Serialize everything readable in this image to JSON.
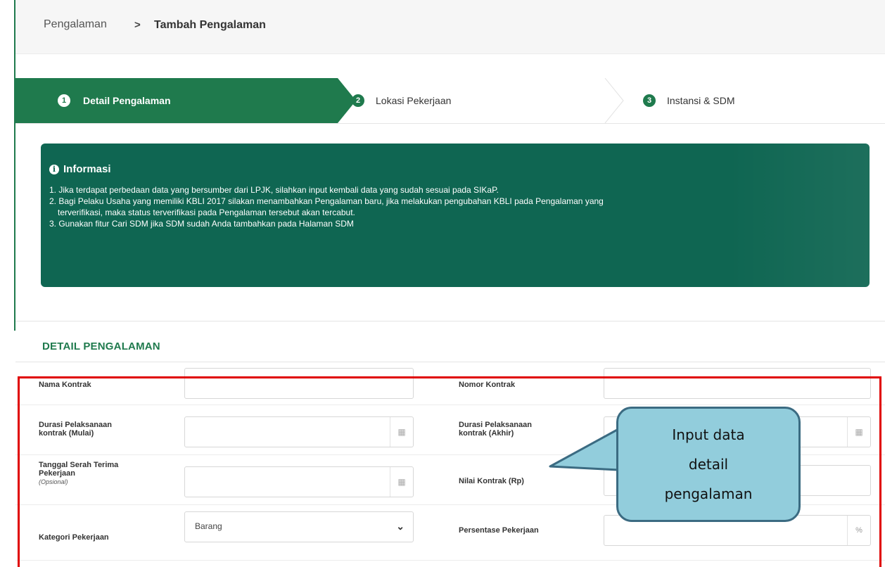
{
  "breadcrumb": {
    "root": "Pengalaman",
    "separator": ">",
    "current": "Tambah Pengalaman"
  },
  "steps": [
    {
      "num": "1",
      "label": "Detail Pengalaman",
      "active": true
    },
    {
      "num": "2",
      "label": "Lokasi Pekerjaan",
      "active": false
    },
    {
      "num": "3",
      "label": "Instansi & SDM",
      "active": false
    }
  ],
  "info": {
    "title": "Informasi",
    "items": [
      "1. Jika terdapat perbedaan data yang bersumber dari LPJK, silahkan input kembali data yang sudah sesuai pada SIKaP.",
      "2. Bagi Pelaku Usaha yang memiliki KBLI 2017 silakan menambahkan Pengalaman baru, jika melakukan pengubahan KBLI pada Pengalaman yang",
      "terverifikasi, maka status terverifikasi pada Pengalaman tersebut akan tercabut.",
      "3. Gunakan fitur Cari SDM jika SDM sudah Anda tambahkan pada Halaman SDM"
    ]
  },
  "section_title": "DETAIL PENGALAMAN",
  "form": {
    "nama_kontrak": {
      "label": "Nama Kontrak",
      "value": ""
    },
    "nomor_kontrak": {
      "label": "Nomor Kontrak",
      "value": ""
    },
    "durasi_mulai": {
      "label_1": "Durasi Pelaksanaan",
      "label_2": "kontrak (Mulai)",
      "value": ""
    },
    "durasi_akhir": {
      "label_1": "Durasi Pelaksanaan",
      "label_2": "kontrak (Akhir)",
      "value": ""
    },
    "tanggal_serah": {
      "label_1": "Tanggal Serah Terima",
      "label_2": "Pekerjaan",
      "optional": "(Opsional)",
      "value": ""
    },
    "nilai_kontrak": {
      "label": "Nilai Kontrak (Rp)",
      "value": ""
    },
    "kategori": {
      "label": "Kategori Pekerjaan",
      "value": "Barang"
    },
    "persentase": {
      "label": "Persentase Pekerjaan",
      "value": "",
      "unit": "%"
    }
  },
  "callout": {
    "line1": "Input data",
    "line2": "detail",
    "line3": "pengalaman"
  },
  "colors": {
    "primary": "#1f7a4d",
    "info_bg": "#0f6652",
    "highlight": "#e00000",
    "callout_fill": "#92cddc",
    "callout_border": "#3b6b82"
  }
}
